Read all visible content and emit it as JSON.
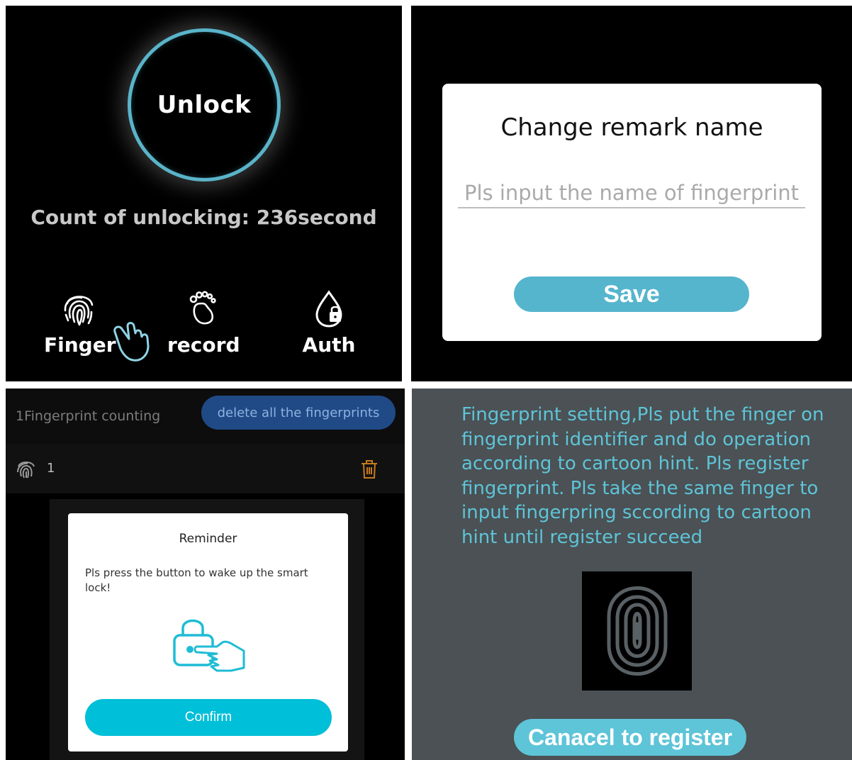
{
  "panel1": {
    "unlock_label": "Unlock",
    "count_text": "Count of unlocking: 236second",
    "nav": [
      {
        "label": "Finger",
        "icon": "fingerprint-icon"
      },
      {
        "label": "record",
        "icon": "footprint-icon"
      },
      {
        "label": "Auth",
        "icon": "drop-lock-icon"
      }
    ],
    "ring_color": "#5ab4c9"
  },
  "panel2": {
    "title": "Change remark name",
    "input_placeholder": "Pls input the name of fingerprint",
    "save_label": "Save",
    "accent": "#55b5cd"
  },
  "panel3": {
    "count_text": "1Fingerprint counting",
    "delete_all_label": "delete all the fingerprints",
    "row_label": "1",
    "dialog": {
      "title": "Reminder",
      "message": "Pls press the button to wake up the smart lock!",
      "confirm_label": "Confirm"
    },
    "accent": "#00bfd8"
  },
  "panel4": {
    "instructions": "Fingerprint setting,Pls put the finger on fingerprint identifier and do operation according to cartoon hint. Pls register fingerprint. Pls take the same finger to input fingerpring sccording to cartoon hint until register succeed",
    "cancel_label": "Canacel to register",
    "accent": "#5ec4d8"
  }
}
